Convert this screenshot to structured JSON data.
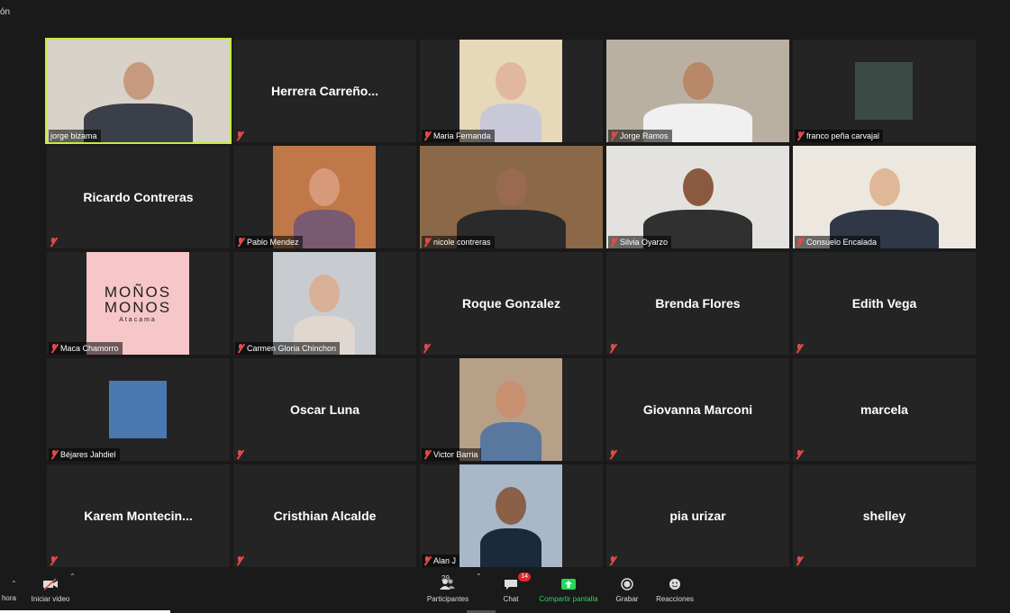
{
  "corner_text": "ón",
  "participants": [
    {
      "name": "jorge bizama",
      "kind": "video",
      "bg": "#d8d2c8",
      "skin": "#c79a80",
      "cloth": "#3b3f4a",
      "active": true
    },
    {
      "name": "Herrera Carreño...",
      "kind": "name"
    },
    {
      "name": "Maria Fernanda",
      "kind": "video",
      "bg": "#e6d8b8",
      "skin": "#e0b8a0",
      "cloth": "#c8c8d8",
      "narrow": true
    },
    {
      "name": "Jorge Ramos",
      "kind": "video",
      "bg": "#b9b0a2",
      "skin": "#b88868",
      "cloth": "#f0f0f0"
    },
    {
      "name": "franco peña carvajal",
      "kind": "thumb",
      "bg": "#3a4a44"
    },
    {
      "name": "Ricardo Contreras",
      "kind": "name"
    },
    {
      "name": "Pablo Mendez",
      "kind": "video",
      "bg": "#c07848",
      "skin": "#d69a78",
      "cloth": "#7a5a70",
      "narrow": true
    },
    {
      "name": "nicole contreras",
      "kind": "video",
      "bg": "#8a6848",
      "skin": "#9a6a50",
      "cloth": "#2a2a2a"
    },
    {
      "name": "Silvia Oyarzo",
      "kind": "video",
      "bg": "#e4e2de",
      "skin": "#8a5a40",
      "cloth": "#303030"
    },
    {
      "name": "Consuelo Encalada",
      "kind": "video",
      "bg": "#ece8e0",
      "skin": "#e0b898",
      "cloth": "#303848"
    },
    {
      "name": "Maca Chamorro",
      "kind": "logo",
      "logo_lines": [
        "MOÑOS",
        "MONOS"
      ],
      "logo_sub": "Atacama",
      "bg": "#f6c6c8"
    },
    {
      "name": "Carmen Gloria Chinchon",
      "kind": "video",
      "bg": "#c8ccd0",
      "skin": "#d8b098",
      "cloth": "#e0d8d0",
      "narrow": true
    },
    {
      "name": "Roque Gonzalez",
      "kind": "name"
    },
    {
      "name": "Brenda Flores",
      "kind": "name"
    },
    {
      "name": "Edith Vega",
      "kind": "name"
    },
    {
      "name": "Béjares Jahdiel",
      "kind": "thumb",
      "bg": "#4a78b0"
    },
    {
      "name": "Oscar Luna",
      "kind": "name"
    },
    {
      "name": "Victor Barria",
      "kind": "video",
      "bg": "#b8a088",
      "skin": "#c89070",
      "cloth": "#5878a0",
      "narrow": true
    },
    {
      "name": "Giovanna Marconi",
      "kind": "name"
    },
    {
      "name": "marcela",
      "kind": "name"
    },
    {
      "name": "Karem  Montecin...",
      "kind": "name"
    },
    {
      "name": "Cristhian Alcalde",
      "kind": "name"
    },
    {
      "name": "Alan J",
      "kind": "video",
      "bg": "#a8b8c8",
      "skin": "#8a6048",
      "cloth": "#1a2a3a",
      "narrow": true
    },
    {
      "name": "pia urizar",
      "kind": "name"
    },
    {
      "name": "shelley",
      "kind": "name"
    }
  ],
  "toolbar": {
    "left_partial": "hora",
    "video_label": "Iniciar video",
    "participants_label": "Participantes",
    "participants_count": "29",
    "chat_label": "Chat",
    "chat_badge": "14",
    "share_label": "Compartir pantalla",
    "record_label": "Grabar",
    "reactions_label": "Reacciones",
    "share_color": "#23d959",
    "muted_color": "#e04a4a"
  }
}
